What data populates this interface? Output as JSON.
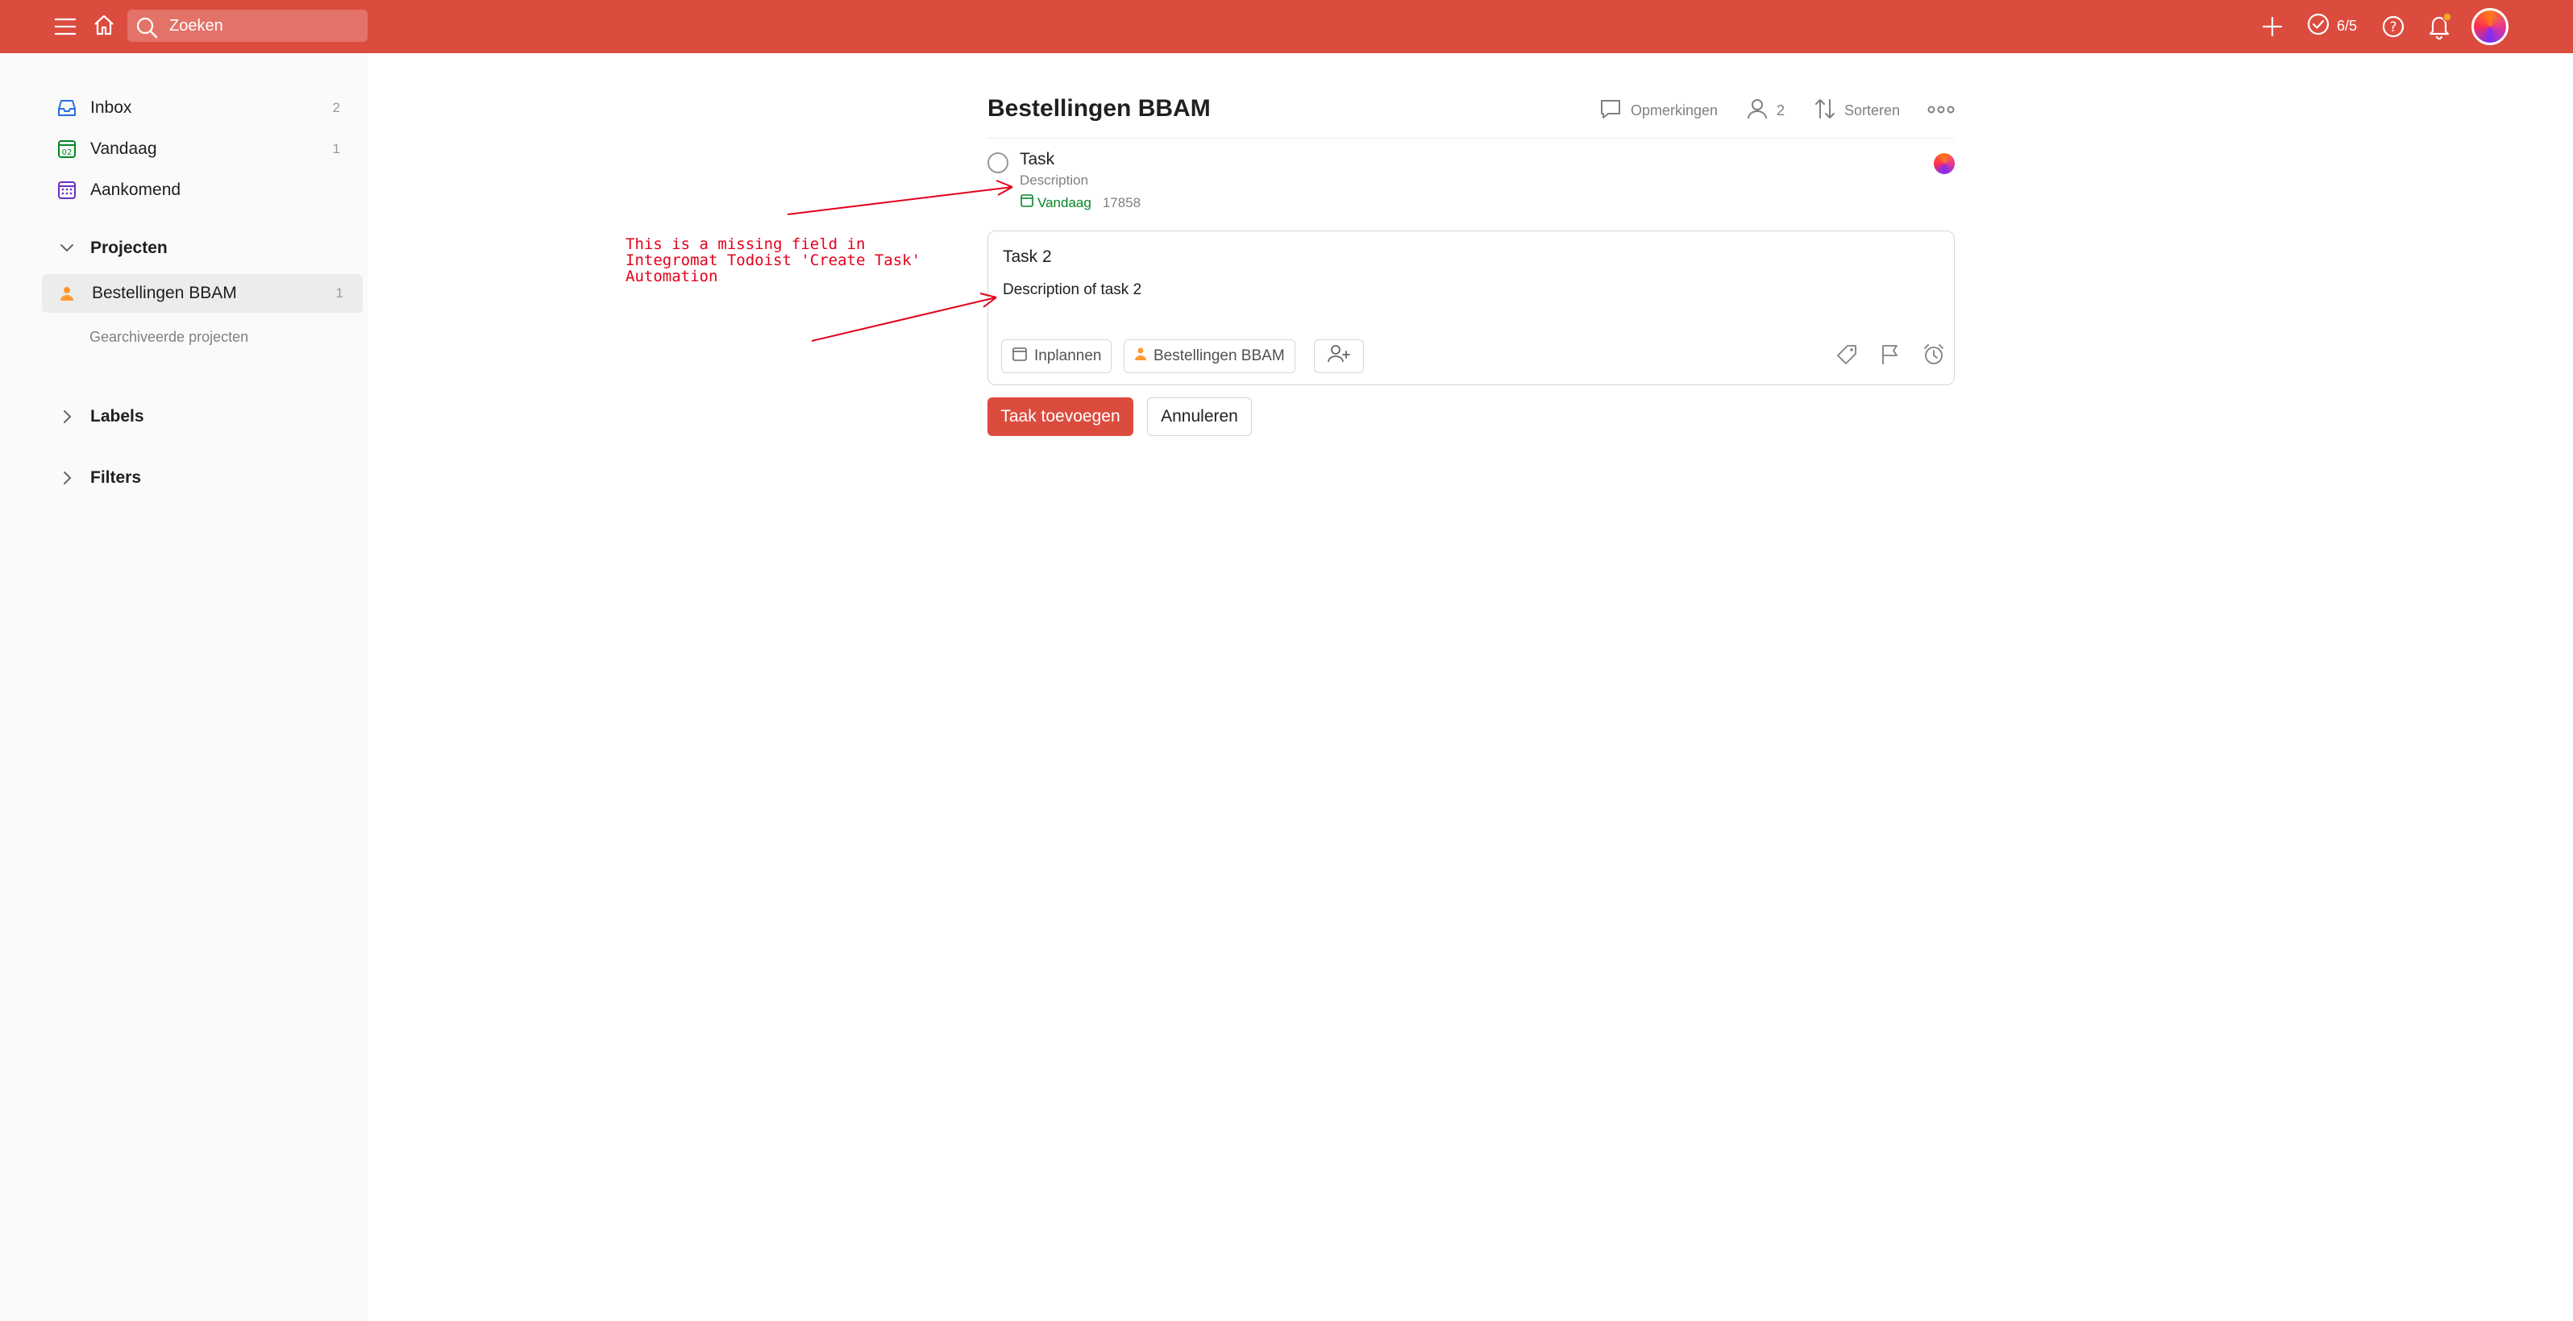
{
  "topbar": {
    "search_placeholder": "Zoeken",
    "karma": "6/5",
    "menu_icon": "menu-icon",
    "home_icon": "home-icon",
    "add_icon": "plus-icon",
    "help_icon": "help-icon",
    "bell_icon": "bell-icon"
  },
  "sidebar": {
    "items": [
      {
        "label": "Inbox",
        "count": "2",
        "icon": "inbox-icon"
      },
      {
        "label": "Vandaag",
        "count": "1",
        "icon": "calendar-today-icon"
      },
      {
        "label": "Aankomend",
        "count": "",
        "icon": "calendar-upcoming-icon"
      }
    ],
    "projects_heading": "Projecten",
    "project": {
      "label": "Bestellingen BBAM",
      "count": "1"
    },
    "archived": "Gearchiveerde projecten",
    "labels_heading": "Labels",
    "filters_heading": "Filters"
  },
  "main": {
    "title": "Bestellingen BBAM",
    "actions": {
      "comments": "Opmerkingen",
      "members": "2",
      "sort": "Sorteren"
    },
    "task": {
      "title": "Task",
      "description": "Description",
      "due": "Vandaag",
      "number": "17858"
    },
    "editor": {
      "title": "Task 2",
      "description": "Description of task 2",
      "schedule": "Inplannen",
      "project": "Bestellingen BBAM"
    },
    "add_button": "Taak toevoegen",
    "cancel_button": "Annuleren"
  },
  "annotation": {
    "text": "This is a missing field in\nIntegromat Todoist 'Create Task'\nAutomation"
  },
  "colors": {
    "brand": "#db4c3f",
    "due_green": "#058527",
    "annotation_red": "#e3001b"
  }
}
